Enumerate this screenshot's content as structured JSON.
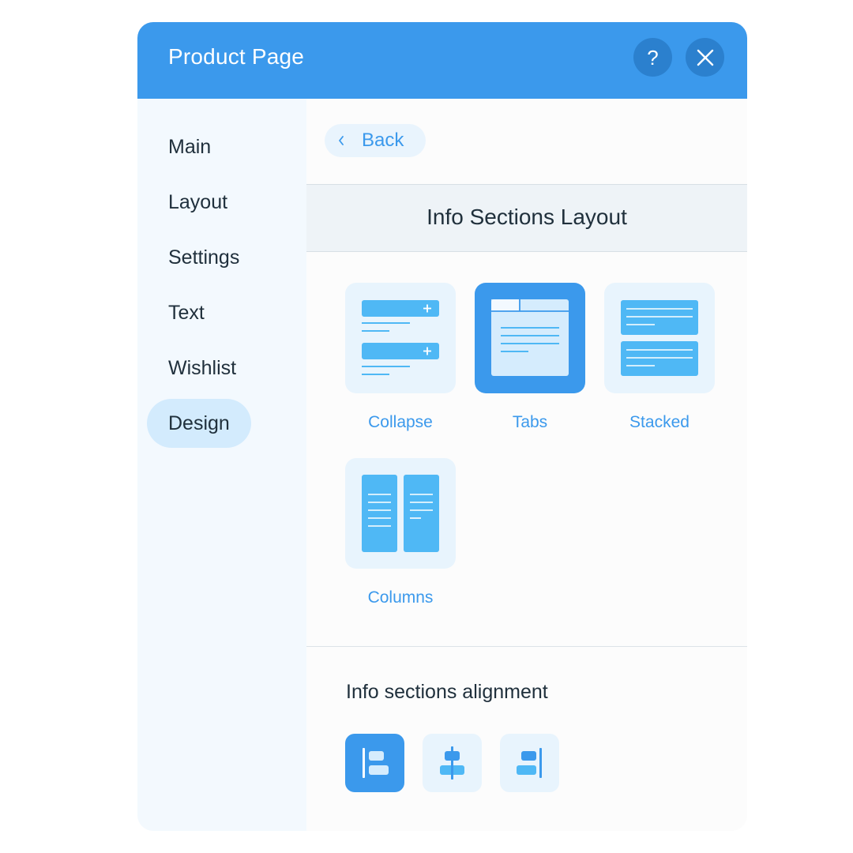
{
  "header": {
    "title": "Product Page",
    "help_icon": "question-mark-icon",
    "close_icon": "close-icon"
  },
  "sidebar": {
    "items": [
      {
        "label": "Main",
        "active": false
      },
      {
        "label": "Layout",
        "active": false
      },
      {
        "label": "Settings",
        "active": false
      },
      {
        "label": "Text",
        "active": false
      },
      {
        "label": "Wishlist",
        "active": false
      },
      {
        "label": "Design",
        "active": true
      }
    ]
  },
  "back": {
    "label": "Back"
  },
  "section": {
    "title": "Info Sections Layout"
  },
  "layout_options": [
    {
      "label": "Collapse",
      "selected": false
    },
    {
      "label": "Tabs",
      "selected": true
    },
    {
      "label": "Stacked",
      "selected": false
    },
    {
      "label": "Columns",
      "selected": false
    }
  ],
  "alignment": {
    "title": "Info sections alignment",
    "options": [
      {
        "icon": "align-left-icon",
        "selected": true
      },
      {
        "icon": "align-center-icon",
        "selected": false
      },
      {
        "icon": "align-right-icon",
        "selected": false
      }
    ]
  },
  "colors": {
    "accent": "#3b99ec",
    "accent_dark": "#2b80ce",
    "tile_bg": "#e8f4fd",
    "sidebar_bg": "#f3f9fe",
    "active_nav_bg": "#d3ebfd",
    "text": "#20303c"
  }
}
